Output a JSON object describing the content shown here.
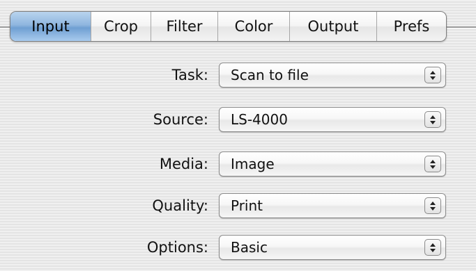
{
  "tabs": [
    {
      "label": "Input",
      "active": true
    },
    {
      "label": "Crop",
      "active": false
    },
    {
      "label": "Filter",
      "active": false
    },
    {
      "label": "Color",
      "active": false
    },
    {
      "label": "Output",
      "active": false
    },
    {
      "label": "Prefs",
      "active": false
    }
  ],
  "form": {
    "task": {
      "label": "Task:",
      "value": "Scan to file"
    },
    "source": {
      "label": "Source:",
      "value": "LS-4000"
    },
    "media": {
      "label": "Media:",
      "value": "Image"
    },
    "quality": {
      "label": "Quality:",
      "value": "Print"
    },
    "options": {
      "label": "Options:",
      "value": "Basic"
    }
  },
  "colors": {
    "active_tab": "#8fb6df",
    "background": "#ececec"
  },
  "icons": {
    "popup_indicator": "up-down-arrows-icon"
  }
}
